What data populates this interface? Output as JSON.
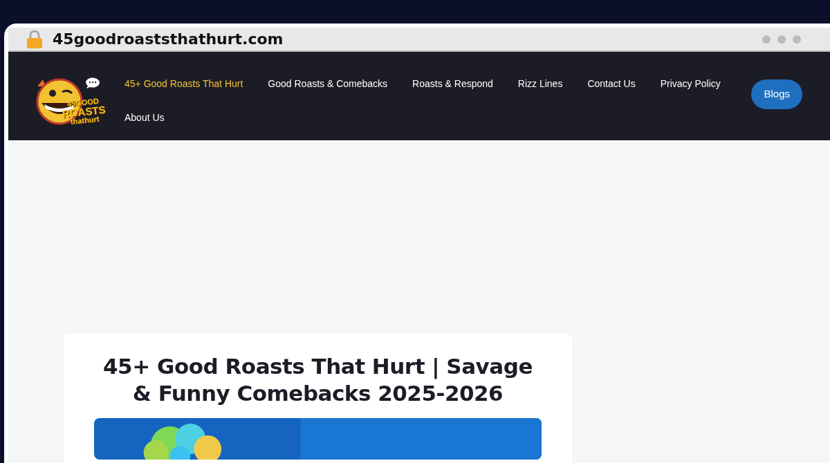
{
  "address_bar": {
    "url": "45goodroaststhathurt.com"
  },
  "logo": {
    "lines": [
      "45GOOD",
      "ROASTS",
      "thathurt"
    ]
  },
  "nav": {
    "items": [
      {
        "label": "45+ Good Roasts That Hurt",
        "selected": true
      },
      {
        "label": "Good Roasts & Comebacks",
        "selected": false
      },
      {
        "label": "Roasts & Respond",
        "selected": false
      },
      {
        "label": "Rizz Lines",
        "selected": false
      },
      {
        "label": "Contact Us",
        "selected": false
      },
      {
        "label": "Privacy Policy",
        "selected": false
      },
      {
        "label": "About Us",
        "selected": false
      }
    ],
    "button": "Blogs"
  },
  "article": {
    "title": "45+ Good Roasts That Hurt | Savage & Funny Comebacks 2025-2026"
  }
}
